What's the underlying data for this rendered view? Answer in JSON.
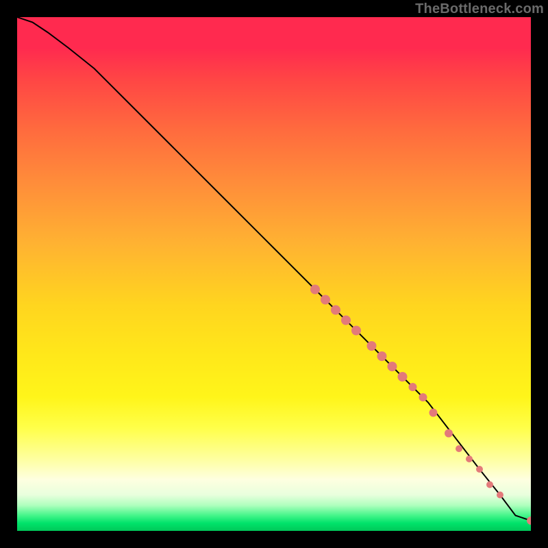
{
  "watermark": "TheBottleneck.com",
  "chart_data": {
    "type": "line",
    "title": "",
    "xlabel": "",
    "ylabel": "",
    "xlim": [
      0,
      100
    ],
    "ylim": [
      0,
      100
    ],
    "grid": false,
    "legend": null,
    "series": [
      {
        "name": "curve",
        "x": [
          0,
          3,
          6,
          10,
          15,
          20,
          30,
          40,
          50,
          60,
          70,
          80,
          90,
          94,
          97,
          100
        ],
        "y": [
          100,
          99,
          97,
          94,
          90,
          85,
          75,
          65,
          55,
          45,
          35,
          25,
          12,
          7,
          3,
          2
        ],
        "stroke": "#000000",
        "stroke_width": 2
      }
    ],
    "markers": [
      {
        "x": 58,
        "y": 47,
        "r": 7,
        "color": "#e37a7a"
      },
      {
        "x": 60,
        "y": 45,
        "r": 7,
        "color": "#e37a7a"
      },
      {
        "x": 62,
        "y": 43,
        "r": 7,
        "color": "#e37a7a"
      },
      {
        "x": 64,
        "y": 41,
        "r": 7,
        "color": "#e37a7a"
      },
      {
        "x": 66,
        "y": 39,
        "r": 7,
        "color": "#e37a7a"
      },
      {
        "x": 69,
        "y": 36,
        "r": 7,
        "color": "#e37a7a"
      },
      {
        "x": 71,
        "y": 34,
        "r": 7,
        "color": "#e37a7a"
      },
      {
        "x": 73,
        "y": 32,
        "r": 7,
        "color": "#e37a7a"
      },
      {
        "x": 75,
        "y": 30,
        "r": 7,
        "color": "#e37a7a"
      },
      {
        "x": 77,
        "y": 28,
        "r": 6,
        "color": "#e37a7a"
      },
      {
        "x": 79,
        "y": 26,
        "r": 6,
        "color": "#e37a7a"
      },
      {
        "x": 81,
        "y": 23,
        "r": 6,
        "color": "#e37a7a"
      },
      {
        "x": 84,
        "y": 19,
        "r": 6,
        "color": "#e37a7a"
      },
      {
        "x": 86,
        "y": 16,
        "r": 5,
        "color": "#e37a7a"
      },
      {
        "x": 88,
        "y": 14,
        "r": 5,
        "color": "#e37a7a"
      },
      {
        "x": 90,
        "y": 12,
        "r": 5,
        "color": "#e37a7a"
      },
      {
        "x": 92,
        "y": 9,
        "r": 5,
        "color": "#e37a7a"
      },
      {
        "x": 94,
        "y": 7,
        "r": 5,
        "color": "#e37a7a"
      },
      {
        "x": 100,
        "y": 2,
        "r": 6,
        "color": "#e37a7a"
      }
    ]
  }
}
